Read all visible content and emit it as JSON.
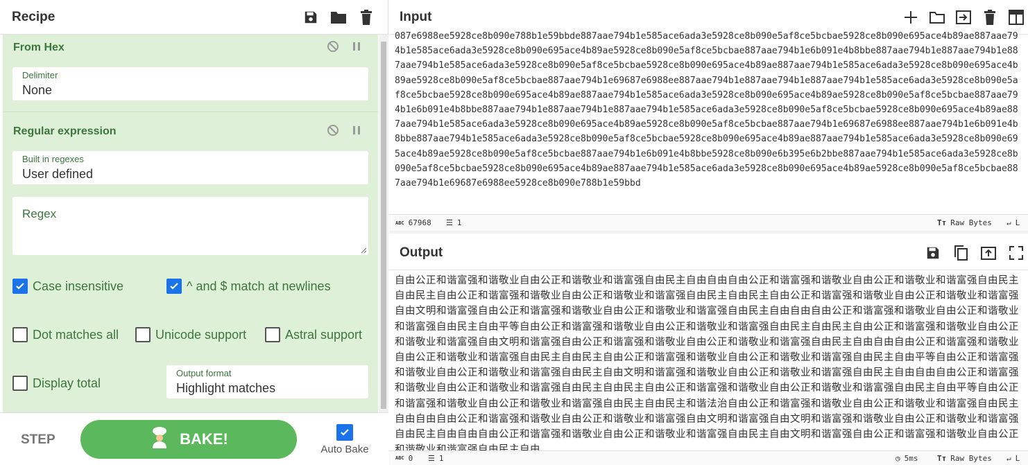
{
  "recipe": {
    "title": "Recipe",
    "ops": [
      {
        "name": "From Hex",
        "fields": [
          {
            "label": "Delimiter",
            "value": "None"
          }
        ]
      },
      {
        "name": "Regular expression",
        "fields": [
          {
            "label": "Built in regexes",
            "value": "User defined"
          },
          {
            "label": "",
            "value": "",
            "placeholder": "Regex"
          }
        ],
        "checks": [
          {
            "label": "Case insensitive",
            "checked": true
          },
          {
            "label": "^ and $ match at newlines",
            "checked": true
          },
          {
            "label": "Dot matches all",
            "checked": false
          },
          {
            "label": "Unicode support",
            "checked": false
          },
          {
            "label": "Astral support",
            "checked": false
          },
          {
            "label": "Display total",
            "checked": false
          }
        ],
        "output_format": {
          "label": "Output format",
          "value": "Highlight matches"
        }
      }
    ],
    "step_label": "STEP",
    "bake_label": "BAKE!",
    "autobake_label": "Auto Bake",
    "autobake_checked": true
  },
  "input": {
    "title": "Input",
    "text": "087e6988ee5928ce8b090e788b1e59bbde887aae794b1e585ace6ada3e5928ce8b090e5af8ce5bcbae5928ce8b090e695ace4b89ae887aae794b1e585ace6ada3e5928ce8b090e695ace4b89ae5928ce8b090e5af8ce5bcbae887aae794b1e6b091e4b8bbe887aae794b1e887aae794b1e887aae794b1e585ace6ada3e5928ce8b090e5af8ce5bcbae5928ce8b090e695ace4b89ae887aae794b1e585ace6ada3e5928ce8b090e695ace4b89ae5928ce8b090e5af8ce5bcbae887aae794b1e69687e6988ee887aae794b1e887aae794b1e887aae794b1e585ace6ada3e5928ce8b090e5af8ce5bcbae5928ce8b090e695ace4b89ae887aae794b1e585ace6ada3e5928ce8b090e695ace4b89ae5928ce8b090e5af8ce5bcbae887aae794b1e6b091e4b8bbe887aae794b1e887aae794b1e887aae794b1e585ace6ada3e5928ce8b090e5af8ce5bcbae5928ce8b090e695ace4b89ae887aae794b1e585ace6ada3e5928ce8b090e695ace4b89ae5928ce8b090e5af8ce5bcbae887aae794b1e69687e6988ee887aae794b1e6b091e4b8bbe887aae794b1e585ace6ada3e5928ce8b090e5af8ce5bcbae5928ce8b090e695ace4b89ae887aae794b1e585ace6ada3e5928ce8b090e695ace4b89ae5928ce8b090e5af8ce5bcbae887aae794b1e6b091e4b8bbe5928ce8b090e6b395e6b2bbe887aae794b1e585ace6ada3e5928ce8b090e5af8ce5bcbae5928ce8b090e695ace4b89ae887aae794b1e585ace6ada3e5928ce8b090e695ace4b89ae5928ce8b090e5af8ce5bcbae887aae794b1e69687e6988ee5928ce8b090e788b1e59bbd",
    "status": {
      "length": "67968",
      "lines": "1",
      "encoding": "Raw Bytes",
      "eol": "L"
    }
  },
  "output": {
    "title": "Output",
    "text": "自由公正和谐富强和谐敬业自由公正和谐敬业和谐富强自由民主自由自由自由公正和谐富强和谐敬业自由公正和谐敬业和谐富强自由民主自由民主自由公正和谐富强和谐敬业自由公正和谐敬业和谐富强自由民主自由民主自由公正和谐富强和谐敬业自由公正和谐敬业和谐富强自由文明和谐富强自由公正和谐富强和谐敬业自由公正和谐敬业和谐富强自由民主自由自由自由公正和谐富强和谐敬业自由公正和谐敬业和谐富强自由民主自由平等自由公正和谐富强和谐敬业自由公正和谐敬业和谐富强自由民主自由民主自由公正和谐富强和谐敬业自由公正和谐敬业和谐富强自由文明和谐富强自由公正和谐富强和谐敬业自由公正和谐敬业和谐富强自由民主自由自由自由公正和谐富强和谐敬业自由公正和谐敬业和谐富强自由民主自由民主自由公正和谐富强和谐敬业自由公正和谐敬业和谐富强自由民主自由平等自由公正和谐富强和谐敬业自由公正和谐敬业和谐富强自由民主自由文明和谐富强和谐敬业自由公正和谐敬业和谐富强自由民主自由自由自由公正和谐富强和谐敬业自由公正和谐敬业和谐富强自由民主自由民主自由公正和谐富强和谐敬业自由公正和谐敬业和谐富强自由民主自由平等自由公正和谐富强和谐敬业自由公正和谐敬业和谐富强自由民主自由民主和谐法治自由公正和谐富强和谐敬业自由公正和谐敬业和谐富强自由民主自由自由自由公正和谐富强和谐敬业自由公正和谐敬业和谐富强自由文明和谐富强自由文明和谐富强和谐敬业自由公正和谐敬业和谐富强自由民主自由自由自由公正和谐富强和谐敬业自由公正和谐敬业和谐富强自由民主自由文明和谐富强自由公正和谐富强和谐敬业自由公正和谐敬业和谐富强自由民主自由",
    "status": {
      "length": "0",
      "lines": "1",
      "time": "5ms",
      "encoding": "Raw Bytes",
      "eol": "L"
    }
  },
  "colors": {
    "accent": "#5cb85c",
    "op_bg": "#dff0d8",
    "op_text": "#3c763d",
    "checkbox": "#1a73e8"
  },
  "icons": {
    "recipe": [
      "save-icon",
      "folder-icon",
      "trash-icon"
    ],
    "input": [
      "plus-icon",
      "folder-icon",
      "input-file-icon",
      "trash-icon",
      "layout-icon"
    ],
    "output": [
      "save-icon",
      "copy-icon",
      "replace-input-icon",
      "maximize-icon"
    ]
  }
}
